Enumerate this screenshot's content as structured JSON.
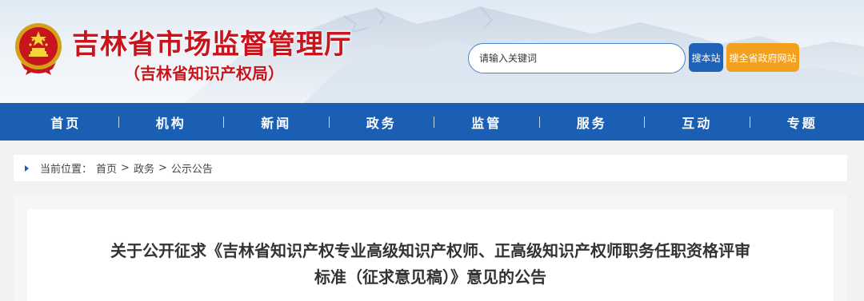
{
  "header": {
    "title": "吉林省市场监督管理厅",
    "subtitle": "（吉林省知识产权局）",
    "emblem_icon": "national-emblem-icon"
  },
  "search": {
    "placeholder": "请输入关键词",
    "site_button": "搜本站",
    "province_button": "搜全省政府网站"
  },
  "nav": {
    "items": [
      {
        "label": "首页"
      },
      {
        "label": "机构"
      },
      {
        "label": "新闻"
      },
      {
        "label": "政务"
      },
      {
        "label": "监管"
      },
      {
        "label": "服务"
      },
      {
        "label": "互动"
      },
      {
        "label": "专题"
      }
    ]
  },
  "breadcrumb": {
    "prefix": "当前位置：",
    "items": [
      "首页",
      "政务",
      "公示公告"
    ],
    "separator": ">"
  },
  "article": {
    "title_line1": "关于公开征求《吉林省知识产权专业高级知识产权师、正高级知识产权师职务任职资格评审",
    "title_line2": "标准（征求意见稿）》意见的公告"
  },
  "colors": {
    "brand_red": "#c8141c",
    "nav_blue": "#1b5fb4",
    "search_button_blue": "#1f62b8",
    "province_button_orange": "#f3a01e"
  }
}
